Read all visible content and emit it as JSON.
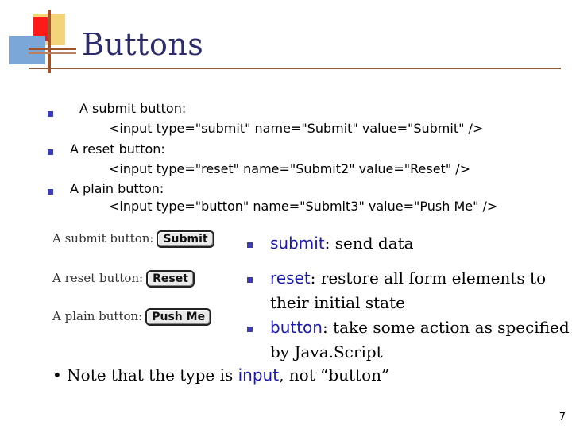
{
  "slide": {
    "title": "Buttons",
    "page_number": "7"
  },
  "code_items": [
    {
      "label": "A submit button:",
      "code": "<input type=\"submit\" name=\"Submit\" value=\"Submit\" />"
    },
    {
      "label": "A reset button:",
      "code": "<input type=\"reset\" name=\"Submit2\" value=\"Reset\" />"
    },
    {
      "label": "A plain button:",
      "code": "<input type=\"button\" name=\"Submit3\" value=\"Push Me\" />"
    }
  ],
  "rendered_buttons": [
    {
      "label": "A submit button:",
      "button": "Submit"
    },
    {
      "label": "A reset button:",
      "button": "Reset"
    },
    {
      "label": "A plain button:",
      "button": "Push Me"
    }
  ],
  "descriptions": [
    {
      "keyword": "submit",
      "text_line1": ": send data",
      "text_line2": ""
    },
    {
      "keyword": "reset",
      "text_line1": ": restore all form elements to",
      "text_line2": "their initial state"
    },
    {
      "keyword": "button",
      "text_line1": ": take some action as specified",
      "text_line2": "by Java.Script"
    }
  ],
  "note": {
    "prefix": "• Note that the type is ",
    "keyword": "input",
    "suffix": ", not “button”"
  },
  "colors": {
    "bullet": "#3d3db0",
    "keyword": "#1a1aa8",
    "title": "#2b2b6b",
    "rule": "#8c5a3c"
  }
}
